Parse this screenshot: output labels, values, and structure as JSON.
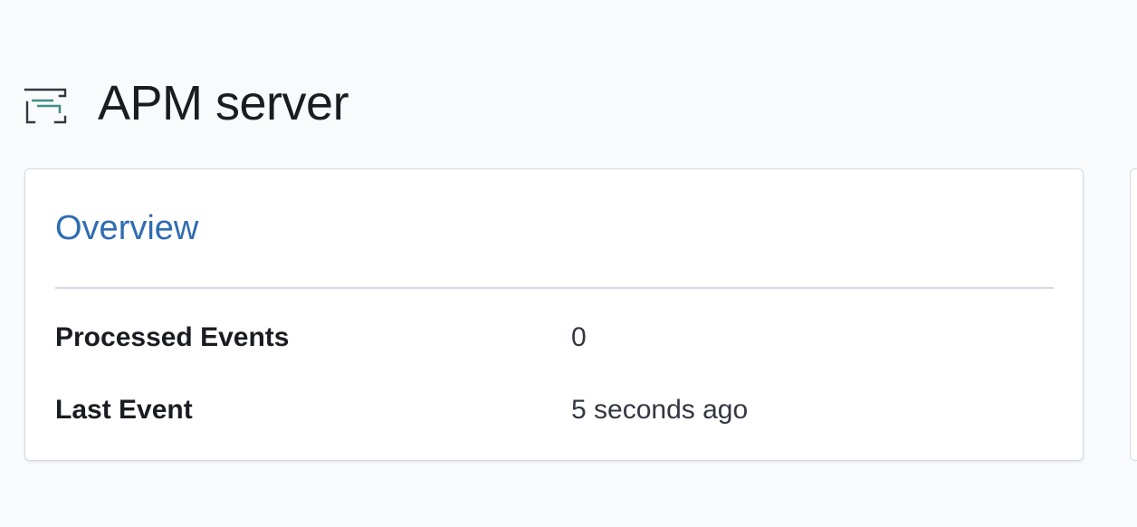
{
  "header": {
    "icon": "apm-server-icon",
    "title": "APM server"
  },
  "overview": {
    "title": "Overview",
    "rows": [
      {
        "label": "Processed Events",
        "value": "0"
      },
      {
        "label": "Last Event",
        "value": "5 seconds ago"
      }
    ]
  },
  "colors": {
    "background": "#f9fafc",
    "panel_border": "#d3dae6",
    "title_link": "#2f6cb2",
    "icon_teal": "#3f8f86",
    "icon_dark": "#343741"
  }
}
